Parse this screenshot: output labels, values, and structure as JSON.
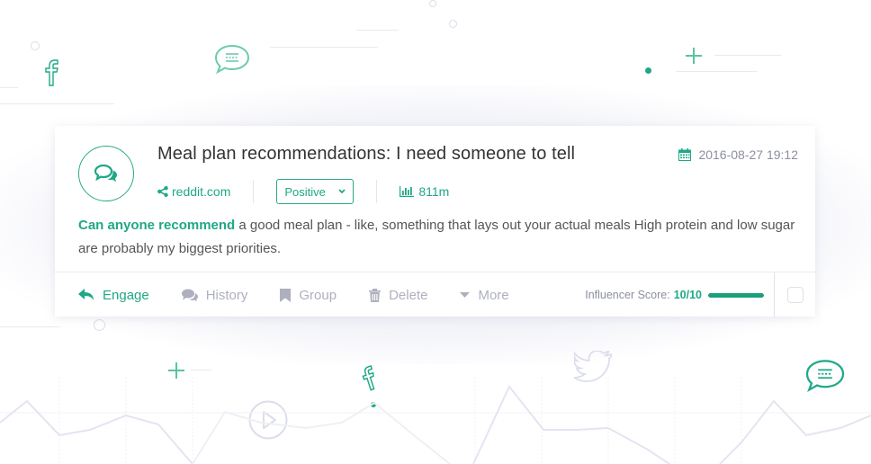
{
  "post": {
    "title": "Meal plan recommendations: I need someone to tell",
    "date": "2016-08-27 19:12",
    "source": "reddit.com",
    "sentiment": {
      "selected": "Positive"
    },
    "reach": "811m",
    "body_highlight": "Can anyone recommend",
    "body_rest": " a good meal plan - like, something that lays out your actual meals High protein and low sugar are probably my biggest priorities."
  },
  "actions": [
    {
      "label": "Engage",
      "icon": "reply-icon"
    },
    {
      "label": "History",
      "icon": "comments-icon"
    },
    {
      "label": "Group",
      "icon": "bookmark-icon"
    },
    {
      "label": "Delete",
      "icon": "trash-icon"
    },
    {
      "label": "More",
      "icon": "caret-down-icon"
    }
  ],
  "influencer": {
    "label": "Influencer Score:",
    "value": "10/10",
    "fraction": 1.0
  },
  "colors": {
    "accent": "#1fa886",
    "muted": "#aeb0bf",
    "text": "#333333"
  }
}
